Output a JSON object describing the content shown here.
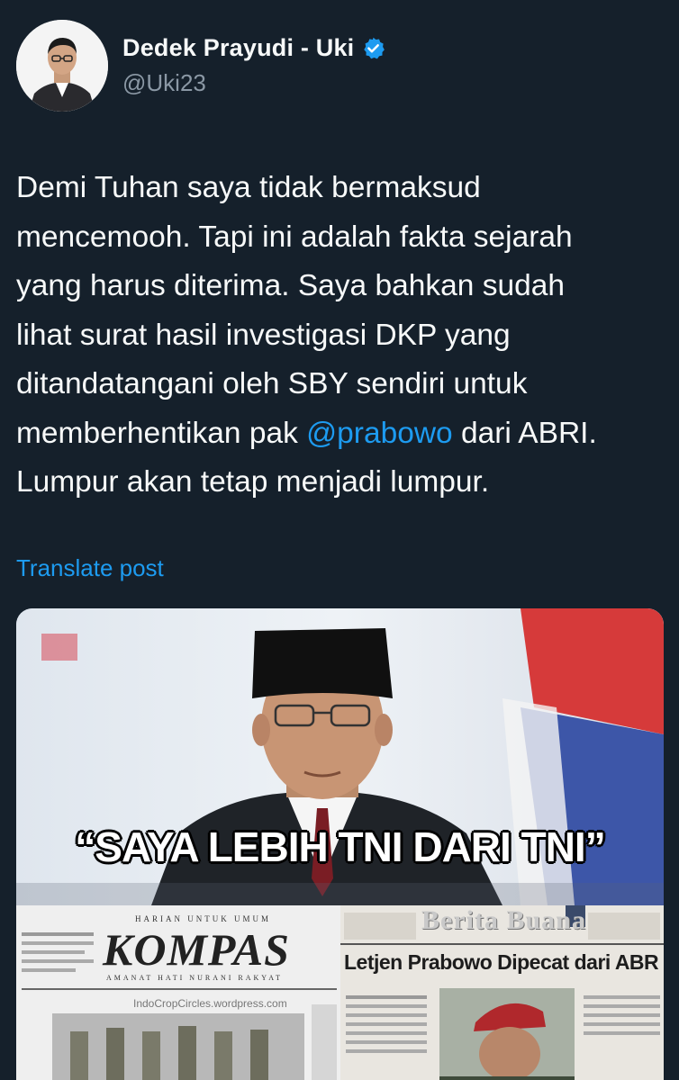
{
  "user": {
    "display_name": "Dedek Prayudi - Uki",
    "handle": "@Uki23",
    "verified": true,
    "avatar_icon": "profile-photo"
  },
  "tweet": {
    "text_before": "Demi Tuhan saya tidak bermaksud\nmencemooh. Tapi ini adalah fakta sejarah\nyang harus diterima. Saya bahkan sudah\nlihat surat hasil investigasi DKP yang\nditandatangani oleh SBY sendiri untuk\nmemberhentikan pak ",
    "mention": "@prabowo",
    "text_after": " dari ABRI.\nLumpur akan tetap menjadi lumpur.",
    "translate_label": "Translate post"
  },
  "media": {
    "caption": "“SAYA LEBIH TNI DARI TNI”",
    "kompas_tagline": "HARIAN UNTUK UMUM",
    "kompas_logo": "KOMPAS",
    "kompas_subtitle": "AMANAT HATI NURANI RAKYAT",
    "kompas_url": "IndoCropCircles.wordpress.com",
    "berita_logo": "Berita Buana",
    "berita_headline": "Letjen Prabowo Dipecat dari ABR"
  },
  "colors": {
    "background": "#15202b",
    "text": "#f7f9f9",
    "secondary": "#8b98a5",
    "link": "#1d9bf0"
  }
}
